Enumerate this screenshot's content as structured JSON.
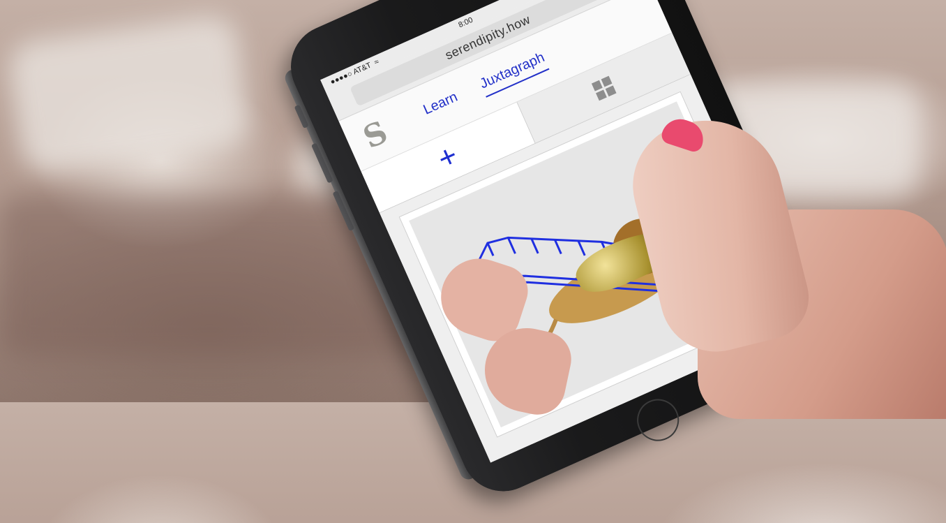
{
  "status": {
    "carrier": "●●●●○ AT&T",
    "time": "8:00"
  },
  "browser": {
    "url": "serendipity.how",
    "reload_icon": "reload-icon"
  },
  "nav": {
    "logo": "S",
    "links": [
      "Learn",
      "Juxtagraph"
    ],
    "active": "Juxtagraph"
  },
  "tools": {
    "add": "+",
    "grid_icon": "grid-icon"
  },
  "card": {
    "close": "×"
  },
  "colors": {
    "accent": "#2230c8",
    "nail": "#e94a6e"
  }
}
